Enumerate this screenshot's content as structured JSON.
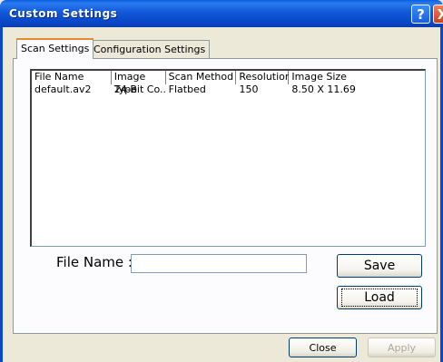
{
  "window": {
    "title": "Custom Settings",
    "help_glyph": "?",
    "close_glyph": "X"
  },
  "tabs": [
    {
      "label": "Scan Settings"
    },
    {
      "label": "Configuration Settings"
    }
  ],
  "list": {
    "columns": [
      "File Name",
      "Image Type",
      "Scan Method",
      "Resolution",
      "Image Size"
    ],
    "rows": [
      [
        "default.av2",
        "24-Bit Co...",
        "Flatbed",
        "150",
        "8.50 X 11.69"
      ]
    ]
  },
  "file_name": {
    "label": "File Name :",
    "value": ""
  },
  "buttons": {
    "save": "Save",
    "load": "Load",
    "close": "Close",
    "apply": "Apply"
  },
  "colors": {
    "titlebar": "#0a48c8",
    "active_tab_accent": "#e68b2c"
  }
}
